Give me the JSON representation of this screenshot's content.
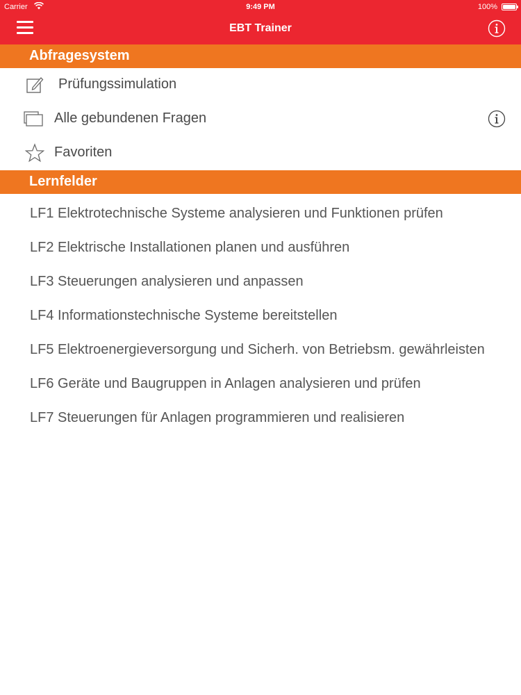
{
  "status_bar": {
    "carrier": "Carrier",
    "time": "9:49 PM",
    "battery": "100%",
    "battery_level": 1.0
  },
  "nav": {
    "title": "EBT Trainer",
    "menu_icon": "hamburger-menu-icon",
    "info_icon": "info-icon"
  },
  "colors": {
    "nav_background": "#ec2630",
    "section_header_background": "#ef7620",
    "text": "#4a4a4a"
  },
  "sections": [
    {
      "title": "Abfragesystem",
      "items": [
        {
          "label": "Prüfungssimulation",
          "icon": "edit-icon"
        },
        {
          "label": "Alle gebundenen Fragen",
          "icon": "stacked-windows-icon",
          "accessory": "info-icon"
        },
        {
          "label": "Favoriten",
          "icon": "star-icon"
        }
      ]
    },
    {
      "title": "Lernfelder",
      "items": [
        {
          "label": "LF1 Elektrotechnische Systeme analysieren und Funktionen prüfen"
        },
        {
          "label": "LF2 Elektrische Installationen planen und ausführen"
        },
        {
          "label": "LF3 Steuerungen analysieren und anpassen"
        },
        {
          "label": "LF4 Informationstechnische Systeme bereitstellen"
        },
        {
          "label": "LF5 Elektroenergieversorgung und Sicherh. von Betriebsm. gewährleisten"
        },
        {
          "label": "LF6 Geräte und Baugruppen in Anlagen analysieren und prüfen"
        },
        {
          "label": "LF7 Steuerungen für Anlagen programmieren und realisieren"
        }
      ]
    }
  ]
}
